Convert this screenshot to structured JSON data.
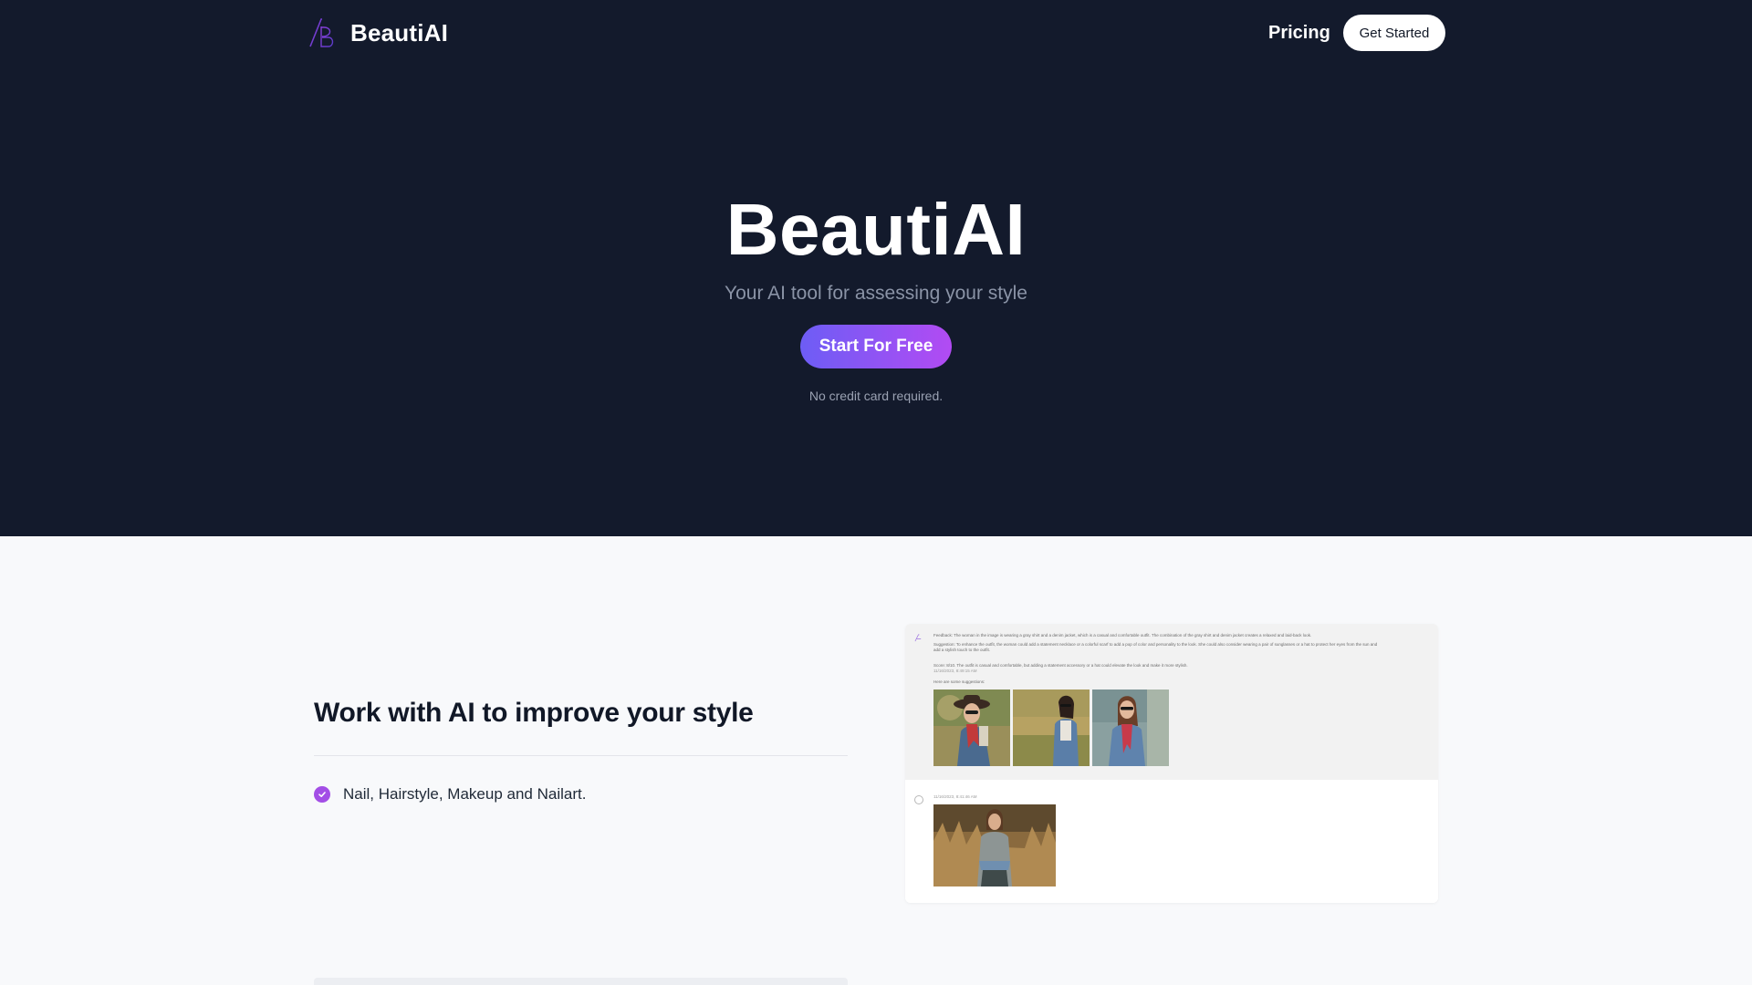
{
  "nav": {
    "brand": "BeautiAI",
    "logo_icon": "beautiai-logo-icon",
    "pricing_label": "Pricing",
    "cta_label": "Get Started"
  },
  "hero": {
    "title": "BeautiAI",
    "subtitle": "Your AI tool for assessing your style",
    "cta_label": "Start For Free",
    "note": "No credit card required."
  },
  "feature": {
    "title": "Work with AI to improve your style",
    "items": [
      {
        "icon": "check-circle-icon",
        "label": "Nail, Hairstyle, Makeup and Nailart."
      }
    ]
  },
  "preview": {
    "assistant_message": {
      "feedback": "Feedback: The woman in the image is wearing a gray shirt and a denim jacket, which is a casual and comfortable outfit. The combination of the gray shirt and denim jacket creates a relaxed and laid-back look.",
      "suggestion_1": "Suggestion: To enhance the outfit, the woman could add a statement necklace or a colorful scarf to add a pop of color and personality to the look. She could also consider wearing a pair of sunglasses or a hat to protect her eyes from the sun and",
      "suggestion_2": "add a stylish touch to the outfit.",
      "score": "Score: 8/10. The outfit is casual and comfortable, but adding a statement accessory or a hat could elevate the look and make it more stylish.",
      "time": "11/16/2023, 8:49:15 AM",
      "suggestions_label": "Here are some suggestions:",
      "images": [
        "woman in hat with red scarf",
        "woman in denim jacket in wheat field",
        "woman in denim jacket with red scarf"
      ]
    },
    "user_message": {
      "time": "11/16/2023, 8:41:46 AM",
      "image": "woman in gray t-shirt in tall grass"
    }
  },
  "colors": {
    "hero_bg": "#131a2c",
    "accent_start": "#6d5df5",
    "accent_end": "#b24bf3",
    "check": "#a34ee6"
  }
}
